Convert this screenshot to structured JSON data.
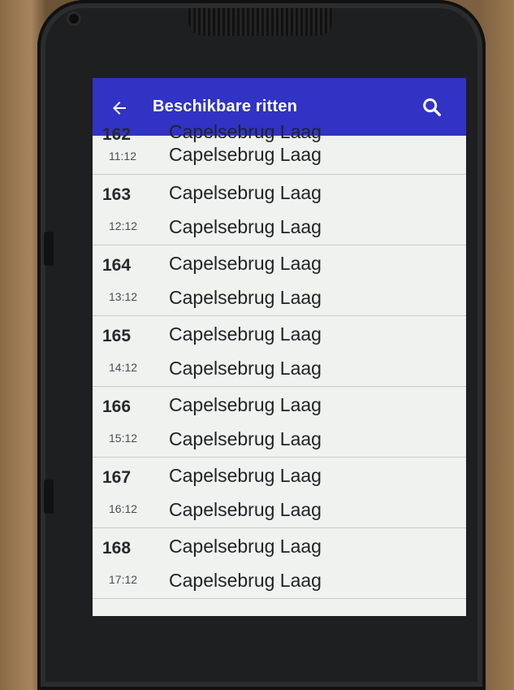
{
  "app_bar": {
    "title": "Beschikbare ritten",
    "back_icon": "arrow-left-icon",
    "search_icon": "search-icon",
    "color": "#3033c4"
  },
  "rides": [
    {
      "number": "162",
      "time": "11:12",
      "from": "Capelsebrug Laag",
      "to": "Capelsebrug Laag"
    },
    {
      "number": "163",
      "time": "12:12",
      "from": "Capelsebrug Laag",
      "to": "Capelsebrug Laag"
    },
    {
      "number": "164",
      "time": "13:12",
      "from": "Capelsebrug Laag",
      "to": "Capelsebrug Laag"
    },
    {
      "number": "165",
      "time": "14:12",
      "from": "Capelsebrug Laag",
      "to": "Capelsebrug Laag"
    },
    {
      "number": "166",
      "time": "15:12",
      "from": "Capelsebrug Laag",
      "to": "Capelsebrug Laag"
    },
    {
      "number": "167",
      "time": "16:12",
      "from": "Capelsebrug Laag",
      "to": "Capelsebrug Laag"
    },
    {
      "number": "168",
      "time": "17:12",
      "from": "Capelsebrug Laag",
      "to": "Capelsebrug Laag"
    }
  ]
}
